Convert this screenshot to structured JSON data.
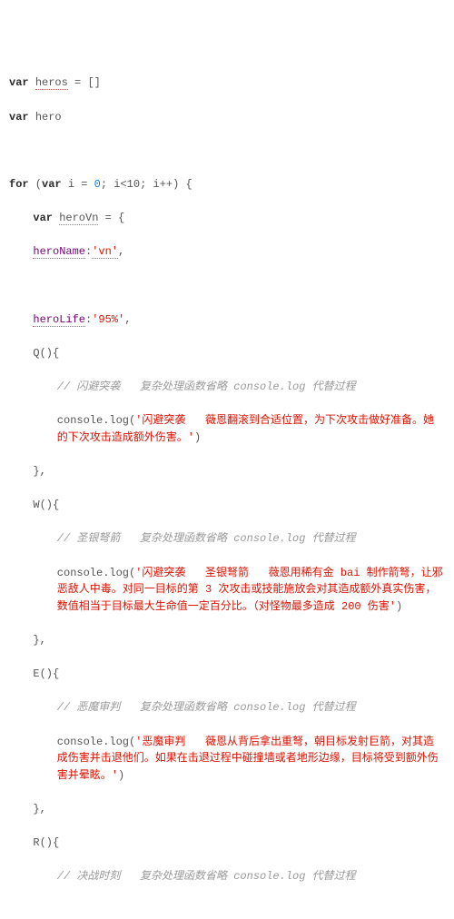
{
  "decl": {
    "var_kw": "var",
    "heros": "heros",
    "heros_init": "[]",
    "hero": "hero"
  },
  "for_loop": {
    "for_kw": "for",
    "var_kw": "var",
    "ivar": "i",
    "init_val": "0",
    "cond": "i<10",
    "step": "i++",
    "heroVn_decl": "heroVn",
    "open": "{"
  },
  "obj": {
    "heroName_key": "heroName",
    "heroName_val": "'vn'",
    "heroLife_key": "heroLife",
    "heroLife_val": "'95%'"
  },
  "methods": {
    "Q": {
      "name": "Q",
      "comment": "// 闪避突袭   复杂处理函数省略 console.log 代替过程",
      "log": "'闪避突袭   薇恩翻滚到合适位置，为下次攻击做好准备。她的下次攻击造成额外伤害。'"
    },
    "W": {
      "name": "W",
      "comment": "// 圣银弩箭   复杂处理函数省略 console.log 代替过程",
      "log": "'闪避突袭   圣银弩箭   薇恩用稀有金 bai 制作箭弩，让邪恶敌人中毒。对同一目标的第 3 次攻击或技能施放会对其造成额外真实伤害，数值相当于目标最大生命值一定百分比。（对怪物最多造成 200 伤害'"
    },
    "E": {
      "name": "E",
      "comment": "// 恶魔审判   复杂处理函数省略 console.log 代替过程",
      "log": "'恶魔审判   薇恩从背后拿出重弩，朝目标发射巨箭，对其造成伤害并击退他们。如果在击退过程中碰撞墙或者地形边缘，目标将受到额外伤害并晕眩。'"
    },
    "R": {
      "name": "R",
      "comment": "// 决战时刻   复杂处理函数省略 console.log 代替过程"
    }
  },
  "tok": {
    "console_log": "console.log",
    "close_brace_comma": "},",
    "paren_open_brace": "(){",
    "comma": ",",
    "eq": " = ",
    "semi": ";",
    "rparen": ")"
  }
}
